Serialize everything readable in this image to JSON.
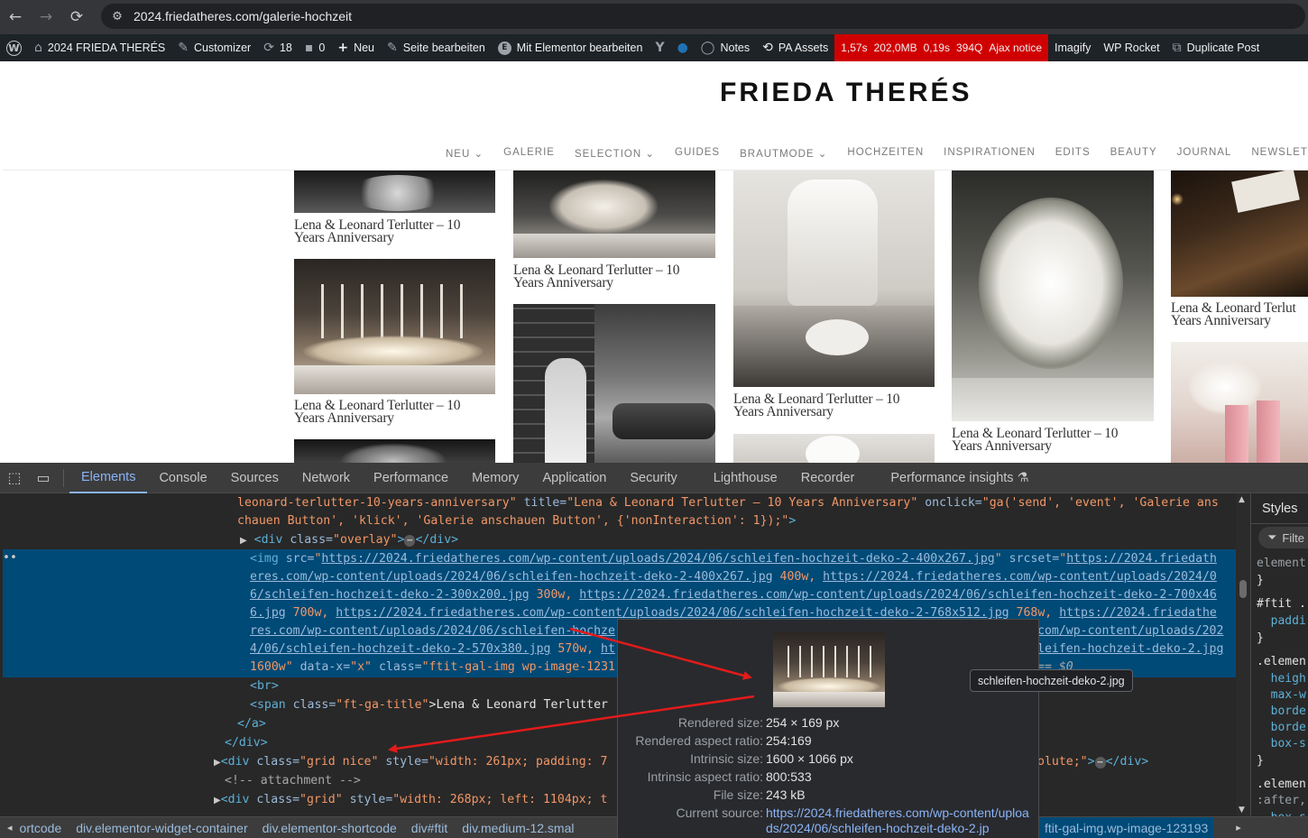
{
  "browser": {
    "back_icon": "←",
    "forward_icon": "→",
    "reload_icon": "⟳",
    "site_info_icon": "⚙",
    "url": "2024.friedatheres.com/galerie-hochzeit"
  },
  "wp_admin_bar": {
    "items": [
      {
        "icon": "W",
        "label": ""
      },
      {
        "icon": "⌂",
        "label": "2024 FRIEDA THERÉS"
      },
      {
        "icon": "✎",
        "label": "Customizer"
      },
      {
        "icon": "⟳",
        "label": "18"
      },
      {
        "icon": "▪",
        "label": "0"
      },
      {
        "icon": "+",
        "label": "Neu"
      },
      {
        "icon": "✎",
        "label": "Seite bearbeiten"
      },
      {
        "icon": "E",
        "label": "Mit Elementor bearbeiten"
      },
      {
        "icon": "Y",
        "label": ""
      },
      {
        "icon": "●",
        "label": ""
      },
      {
        "icon": "◯",
        "label": "Notes"
      },
      {
        "icon": "⟲",
        "label": "PA Assets"
      }
    ],
    "perf": [
      "1,57s",
      "202,0MB",
      "0,19s",
      "394Q",
      "Ajax notice"
    ],
    "items_after": [
      {
        "icon": "",
        "label": "Imagify"
      },
      {
        "icon": "",
        "label": "WP Rocket"
      },
      {
        "icon": "⧉",
        "label": "Duplicate Post"
      }
    ]
  },
  "site": {
    "logo": "FRIEDA THERÉS",
    "menu": [
      "NEU ⌄",
      "GALERIE",
      "SELECTION ⌄",
      "GUIDES",
      "BRAUTMODE ⌄",
      "HOCHZEITEN",
      "INSPIRATIONEN",
      "EDITS",
      "BEAUTY",
      "JOURNAL",
      "NEWSLETTER"
    ],
    "caption_line1": "Lena & Leonard Terlutter – 10",
    "caption_line2": "Years Anniversary",
    "caption_cut_line1": "Lena & Leonard Terlut",
    "caption_cut_line2": "Years Anniversary"
  },
  "devtools": {
    "tool_icons": {
      "inspect": "⬚",
      "device": "▭"
    },
    "tabs": [
      "Elements",
      "Console",
      "Sources",
      "Network",
      "Performance",
      "Memory",
      "Application",
      "Security",
      "Lighthouse",
      "Recorder",
      "Performance insights ⚗"
    ],
    "active_tab": "Elements",
    "code": {
      "l1_val": "leonard-terlutter-10-years-anniversary\"",
      "l1_a1": " title=",
      "l1_v1": "\"Lena & Leonard Terlutter – 10 Years Anniversary\"",
      "l1_a2": " onclick=",
      "l1_v2": "\"ga('send', 'event', 'Galerie ans",
      "l2_val": "chauen Button', 'klick', 'Galerie anschauen Button', {'nonInteraction': 1});\"",
      "l2_end": ">",
      "l3_tag": "<div",
      "l3_a": " class=",
      "l3_v": "\"overlay\"",
      "l3_end1": ">",
      "l3_dots": "⋯",
      "l3_end2": "</div>",
      "sel_marker": "••",
      "img_open": "<img",
      "img_src_a": " src=",
      "img_src_q": "\"",
      "img_src_link": "https://2024.friedatheres.com/wp-content/uploads/2024/06/schleifen-hochzeit-deko-2-400x267.jpg",
      "img_srcset_a": " srcset=",
      "img_srcset_l1": "https://2024.friedath",
      "s2_l1": "eres.com/wp-content/uploads/2024/06/schleifen-hochzeit-deko-2-400x267.jpg",
      "s2_w1": " 400w, ",
      "s2_l2": "https://2024.friedatheres.com/wp-content/uploads/2024/0",
      "s3_l1": "6/schleifen-hochzeit-deko-2-300x200.jpg",
      "s3_w1": " 300w, ",
      "s3_l2": "https://2024.friedatheres.com/wp-content/uploads/2024/06/schleifen-hochzeit-deko-2-700x46",
      "s4_l1": "6.jpg",
      "s4_w1": " 700w, ",
      "s4_l2": "https://2024.friedatheres.com/wp-content/uploads/2024/06/schleifen-hochzeit-deko-2-768x512.jpg",
      "s4_w2": " 768w, ",
      "s4_l3": "https://2024.friedathe",
      "s5_l1": "res.com/wp-content/uploads/2024/06/schleifen-hochze",
      "s5_l2": "com/wp-content/uploads/202",
      "s6_l1": "4/06/schleifen-hochzeit-deko-2-570x380.jpg",
      "s6_w1": " 570w, ",
      "s6_l2": "ht",
      "s6_l3": "leifen-hochzeit-deko-2.jpg",
      "s7_w": "1600w\"",
      "s7_a1": " data-x=",
      "s7_v1": "\"x\"",
      "s7_a2": " class=",
      "s7_v2": "\"ftit-gal-img wp-image-1231",
      "s7_eq": "== $0",
      "br": "<br>",
      "span_open": "<span",
      "span_a": " class=",
      "span_v": "\"ft-ga-title\"",
      "span_text": ">Lena & Leonard Terlutter",
      "a_close": "</a>",
      "div_close": "</div>",
      "grid1_tag": "<div",
      "grid1_a": " class=",
      "grid1_v": "\"grid nice\"",
      "grid1_a2": " style=",
      "grid1_v2": "\"width: 261px; padding: 7",
      "grid1_tail": "olute;\"",
      "grid1_end": ">",
      "grid1_dots": "⋯",
      "grid1_close": "</div>",
      "comment": "<!-- attachment -->",
      "grid2_tag": "<div",
      "grid2_a": " class=",
      "grid2_v": "\"grid\"",
      "grid2_a2": " style=",
      "grid2_v2": "\"width: 268px; left: 1104px; t"
    },
    "styles": {
      "tab": "Styles",
      "filter": "Filte",
      "lines": [
        "element",
        "}",
        "#ftit .",
        "  paddi",
        "}",
        ".elemen",
        "  heigh",
        "  max-w",
        "  borde",
        "  borde",
        "  box-s",
        "}",
        ".elemen",
        ":after,",
        "  box-s",
        "}"
      ]
    },
    "breadcrumbs": [
      "◂",
      "ortcode",
      "div.elementor-widget-container",
      "div.elementor-shortcode",
      "div#ftit",
      "div.medium-12.smal"
    ],
    "breadcrumb_tail": "ftit-gal-img.wp-image-123193",
    "tooltip": {
      "rendered_size_label": "Rendered size:",
      "rendered_size": "254 × 169 px",
      "rendered_ratio_label": "Rendered aspect ratio:",
      "rendered_ratio": "254:169",
      "intrinsic_size_label": "Intrinsic size:",
      "intrinsic_size": "1600 × 1066 px",
      "intrinsic_ratio_label": "Intrinsic aspect ratio:",
      "intrinsic_ratio": "800:533",
      "file_size_label": "File size:",
      "file_size": "243 kB",
      "current_source_label": "Current source:",
      "current_source": "https://2024.friedatheres.com/wp-content/uploads/2024/06/schleifen-hochzeit-deko-2.jp"
    },
    "file_tooltip": "schleifen-hochzeit-deko-2.jpg"
  },
  "colors": {
    "chrome": "#35363a",
    "wp_admin": "#1d2327",
    "perf_red": "#d00000",
    "devtools_bg": "#282828",
    "selection": "#004a77",
    "arrow": "#e21b1b"
  }
}
